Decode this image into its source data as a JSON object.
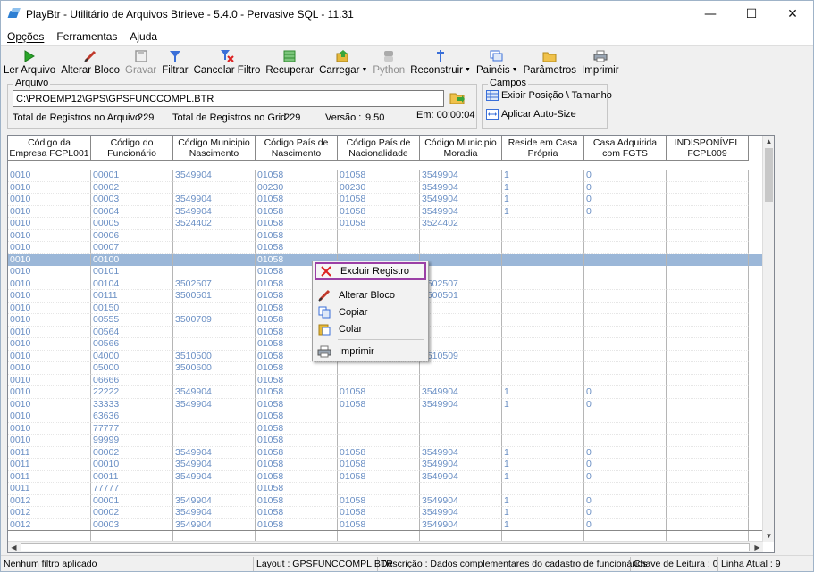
{
  "window": {
    "title": "PlayBtr - Utilitário de Arquivos Btrieve - 5.4.0 - Pervasive SQL - 11.31",
    "minimize": "—",
    "maximize": "☐",
    "close": "✕"
  },
  "menu": {
    "items": [
      {
        "label": "Opções",
        "key": "O"
      },
      {
        "label": "Ferramentas",
        "key": "F"
      },
      {
        "label": "Ajuda",
        "key": "A"
      }
    ]
  },
  "toolbar": {
    "ler_arquivo": "Ler Arquivo",
    "alterar_bloco": "Alterar Bloco",
    "gravar": "Gravar",
    "filtrar": "Filtrar",
    "cancelar_filtro": "Cancelar Filtro",
    "recuperar": "Recuperar",
    "carregar": "Carregar",
    "python": "Python",
    "reconstruir": "Reconstruir",
    "paineis": "Painéis",
    "parametros": "Parâmetros",
    "imprimir": "Imprimir"
  },
  "arquivo": {
    "legend": "Arquivo",
    "path": "C:\\PROEMP12\\GPS\\GPSFUNCCOMPL.BTR",
    "total_arquivo_label": "Total de Registros no Arquivo :",
    "total_arquivo": "229",
    "total_grid_label": "Total de Registros no Grid :",
    "total_grid": "229",
    "versao_label": "Versão :",
    "versao": "9.50",
    "tempo": "Em: 00:00:04"
  },
  "campos": {
    "legend": "Campos",
    "exibir": "Exibir Posição \\ Tamanho",
    "aplicar": "Aplicar Auto-Size"
  },
  "grid": {
    "headers": [
      "Código da Empresa FCPL001",
      "Código do Funcionário",
      "Código Municipio Nascimento",
      "Código País de Nascimento",
      "Código País de Nacionalidade",
      "Código Municipio Moradia",
      "Reside em Casa Própria",
      "Casa Adquirida com FGTS",
      "INDISPONÍVEL FCPL009"
    ],
    "rows": [
      [
        "0010",
        "00001",
        "3549904",
        "01058",
        "01058",
        "3549904",
        "1",
        "0",
        ""
      ],
      [
        "0010",
        "00002",
        "",
        "00230",
        "00230",
        "3549904",
        "1",
        "0",
        ""
      ],
      [
        "0010",
        "00003",
        "3549904",
        "01058",
        "01058",
        "3549904",
        "1",
        "0",
        ""
      ],
      [
        "0010",
        "00004",
        "3549904",
        "01058",
        "01058",
        "3549904",
        "1",
        "0",
        ""
      ],
      [
        "0010",
        "00005",
        "3524402",
        "01058",
        "01058",
        "3524402",
        "",
        "",
        ""
      ],
      [
        "0010",
        "00006",
        "",
        "01058",
        "",
        "",
        "",
        "",
        ""
      ],
      [
        "0010",
        "00007",
        "",
        "01058",
        "",
        "",
        "",
        "",
        ""
      ],
      [
        "0010",
        "00100",
        "",
        "01058",
        "",
        "",
        "",
        "",
        ""
      ],
      [
        "0010",
        "00101",
        "",
        "01058",
        "",
        "",
        "",
        "",
        ""
      ],
      [
        "0010",
        "00104",
        "3502507",
        "01058",
        "",
        "3502507",
        "",
        "",
        ""
      ],
      [
        "0010",
        "00111",
        "3500501",
        "01058",
        "",
        "3500501",
        "",
        "",
        ""
      ],
      [
        "0010",
        "00150",
        "",
        "01058",
        "",
        "",
        "",
        "",
        ""
      ],
      [
        "0010",
        "00555",
        "3500709",
        "01058",
        "",
        "",
        "",
        "",
        ""
      ],
      [
        "0010",
        "00564",
        "",
        "01058",
        "",
        "",
        "",
        "",
        ""
      ],
      [
        "0010",
        "00566",
        "",
        "01058",
        "",
        "",
        "",
        "",
        ""
      ],
      [
        "0010",
        "04000",
        "3510500",
        "01058",
        "",
        "3510509",
        "",
        "",
        ""
      ],
      [
        "0010",
        "05000",
        "3500600",
        "01058",
        "",
        "",
        "",
        "",
        ""
      ],
      [
        "0010",
        "06666",
        "",
        "01058",
        "",
        "",
        "",
        "",
        ""
      ],
      [
        "0010",
        "22222",
        "3549904",
        "01058",
        "01058",
        "3549904",
        "1",
        "0",
        ""
      ],
      [
        "0010",
        "33333",
        "3549904",
        "01058",
        "01058",
        "3549904",
        "1",
        "0",
        ""
      ],
      [
        "0010",
        "63636",
        "",
        "01058",
        "",
        "",
        "",
        "",
        ""
      ],
      [
        "0010",
        "77777",
        "",
        "01058",
        "",
        "",
        "",
        "",
        ""
      ],
      [
        "0010",
        "99999",
        "",
        "01058",
        "",
        "",
        "",
        "",
        ""
      ],
      [
        "0011",
        "00002",
        "3549904",
        "01058",
        "01058",
        "3549904",
        "1",
        "0",
        ""
      ],
      [
        "0011",
        "00010",
        "3549904",
        "01058",
        "01058",
        "3549904",
        "1",
        "0",
        ""
      ],
      [
        "0011",
        "00011",
        "3549904",
        "01058",
        "01058",
        "3549904",
        "1",
        "0",
        ""
      ],
      [
        "0011",
        "77777",
        "",
        "01058",
        "",
        "",
        "",
        "",
        ""
      ],
      [
        "0012",
        "00001",
        "3549904",
        "01058",
        "01058",
        "3549904",
        "1",
        "0",
        ""
      ],
      [
        "0012",
        "00002",
        "3549904",
        "01058",
        "01058",
        "3549904",
        "1",
        "0",
        ""
      ],
      [
        "0012",
        "00003",
        "3549904",
        "01058",
        "01058",
        "3549904",
        "1",
        "0",
        ""
      ]
    ],
    "selected_row": 7
  },
  "context_menu": {
    "excluir": "Excluir Registro",
    "alterar": "Alterar Bloco",
    "copiar": "Copiar",
    "colar": "Colar",
    "imprimir": "Imprimir"
  },
  "status": {
    "filtro": "Nenhum filtro aplicado",
    "layout": "Layout : GPSFUNCCOMPL.BTR",
    "descricao": "Descrição : Dados complementares do cadastro de funcionários",
    "chave": "Chave de Leitura : 0",
    "linha": "Linha Atual : 9"
  },
  "colors": {
    "accent_selected_row": "#9bb7d8",
    "cell_text": "#6a8fc4",
    "highlight_border": "#9b3fa6"
  }
}
